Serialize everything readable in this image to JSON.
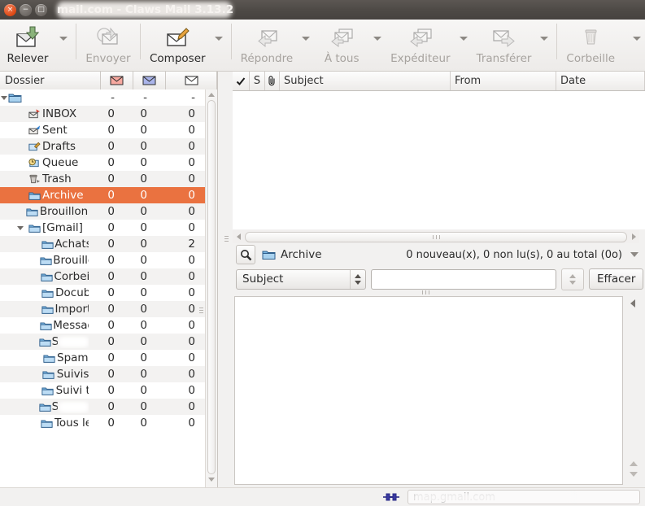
{
  "window": {
    "title_visible": "mail.com - Claws Mail 3.13.2",
    "title_redacted": true,
    "buttons": {
      "close": "×",
      "minimize": "−",
      "maximize": "□"
    },
    "accent_color": "#dd4814",
    "titlebar_color": "#4e4a46"
  },
  "toolbar": {
    "items": [
      {
        "label": "Relever",
        "icon": "get-mail-icon",
        "enabled": true,
        "has_arrow": true
      },
      {
        "label": "Envoyer",
        "icon": "send-mail-icon",
        "enabled": false,
        "has_arrow": false
      },
      {
        "label": "Composer",
        "icon": "compose-mail-icon",
        "enabled": true,
        "has_arrow": true
      },
      {
        "label": "Répondre",
        "icon": "reply-icon",
        "enabled": false,
        "has_arrow": true
      },
      {
        "label": "À tous",
        "icon": "reply-all-icon",
        "enabled": false,
        "has_arrow": true
      },
      {
        "label": "Expéditeur",
        "icon": "reply-sender-icon",
        "enabled": false,
        "has_arrow": true
      },
      {
        "label": "Transférer",
        "icon": "forward-icon",
        "enabled": false,
        "has_arrow": true
      },
      {
        "label": "Corbeille",
        "icon": "trash-icon",
        "enabled": false,
        "has_arrow": true
      }
    ]
  },
  "folder_pane": {
    "columns": [
      {
        "label": "Dossier",
        "icon": ""
      },
      {
        "label": "",
        "icon": "new-mail-icon"
      },
      {
        "label": "",
        "icon": "unread-mail-icon"
      },
      {
        "label": "",
        "icon": "total-mail-icon"
      }
    ],
    "rows": [
      {
        "name": "",
        "redacted": true,
        "icon": "account-folder-icon",
        "indent": 0,
        "twisty": "open",
        "new": "-",
        "unread": "-",
        "total": "-",
        "selected": false
      },
      {
        "name": "INBOX",
        "icon": "inbox-icon",
        "indent": 1,
        "twisty": "none",
        "new": "0",
        "unread": "0",
        "total": "0",
        "selected": false
      },
      {
        "name": "Sent",
        "icon": "sent-icon",
        "indent": 1,
        "twisty": "none",
        "new": "0",
        "unread": "0",
        "total": "0",
        "selected": false
      },
      {
        "name": "Drafts",
        "icon": "drafts-icon",
        "indent": 1,
        "twisty": "none",
        "new": "0",
        "unread": "0",
        "total": "0",
        "selected": false
      },
      {
        "name": "Queue",
        "icon": "queue-icon",
        "indent": 1,
        "twisty": "none",
        "new": "0",
        "unread": "0",
        "total": "0",
        "selected": false
      },
      {
        "name": "Trash",
        "icon": "trash-folder-icon",
        "indent": 1,
        "twisty": "none",
        "new": "0",
        "unread": "0",
        "total": "0",
        "selected": false
      },
      {
        "name": "Archive",
        "icon": "folder-icon",
        "indent": 1,
        "twisty": "none",
        "new": "0",
        "unread": "0",
        "total": "0",
        "selected": true
      },
      {
        "name": "Brouillons",
        "icon": "folder-icon",
        "indent": 1,
        "twisty": "none",
        "new": "0",
        "unread": "0",
        "total": "0",
        "selected": false
      },
      {
        "name": "[Gmail]",
        "icon": "folder-icon",
        "indent": 1,
        "twisty": "open",
        "new": "0",
        "unread": "0",
        "total": "0",
        "selected": false
      },
      {
        "name": "Achats",
        "icon": "folder-icon",
        "indent": 2,
        "twisty": "none",
        "new": "0",
        "unread": "0",
        "total": "2",
        "selected": false
      },
      {
        "name": "Brouillo",
        "icon": "folder-icon",
        "indent": 2,
        "twisty": "none",
        "new": "0",
        "unread": "0",
        "total": "0",
        "selected": false
      },
      {
        "name": "Corbeil",
        "icon": "folder-icon",
        "indent": 2,
        "twisty": "none",
        "new": "0",
        "unread": "0",
        "total": "0",
        "selected": false
      },
      {
        "name": "Docub",
        "icon": "folder-icon",
        "indent": 2,
        "twisty": "none",
        "new": "0",
        "unread": "0",
        "total": "0",
        "selected": false
      },
      {
        "name": "Import",
        "icon": "folder-icon",
        "indent": 2,
        "twisty": "none",
        "new": "0",
        "unread": "0",
        "total": "0",
        "selected": false
      },
      {
        "name": "Messag",
        "icon": "folder-icon",
        "indent": 2,
        "twisty": "none",
        "new": "0",
        "unread": "0",
        "total": "0",
        "selected": false
      },
      {
        "name": "S",
        "redacted": true,
        "icon": "folder-icon",
        "indent": 2,
        "twisty": "none",
        "new": "0",
        "unread": "0",
        "total": "0",
        "selected": false
      },
      {
        "name": "Spam",
        "icon": "folder-icon",
        "indent": 2,
        "twisty": "none",
        "new": "0",
        "unread": "0",
        "total": "0",
        "selected": false
      },
      {
        "name": "Suivis",
        "icon": "folder-icon",
        "indent": 2,
        "twisty": "none",
        "new": "0",
        "unread": "0",
        "total": "0",
        "selected": false
      },
      {
        "name": "Suivi t",
        "icon": "folder-icon",
        "indent": 2,
        "twisty": "none",
        "new": "0",
        "unread": "0",
        "total": "0",
        "selected": false
      },
      {
        "name": "S",
        "redacted": true,
        "icon": "folder-icon",
        "indent": 2,
        "twisty": "none",
        "new": "0",
        "unread": "0",
        "total": "0",
        "selected": false
      },
      {
        "name": "Tous le",
        "icon": "folder-icon",
        "indent": 2,
        "twisty": "none",
        "new": "0",
        "unread": "0",
        "total": "0",
        "selected": false
      }
    ],
    "selected_color": "#ea7240"
  },
  "message_list": {
    "columns": [
      {
        "label": "",
        "icon": "checkmark-icon"
      },
      {
        "label": "S",
        "icon": ""
      },
      {
        "label": "",
        "icon": "paperclip-icon"
      },
      {
        "label": "Subject",
        "icon": ""
      },
      {
        "label": "From",
        "icon": ""
      },
      {
        "label": "Date",
        "icon": ""
      }
    ],
    "rows": []
  },
  "status": {
    "folder_name": "Archive",
    "counts": "0 nouveau(x), 0 non lu(s), 0 au total (0o)",
    "search_icon": "magnifier-icon"
  },
  "search": {
    "field_selected": "Subject",
    "query_value": "",
    "query_placeholder": "",
    "clear_label": "Effacer"
  },
  "statusbar": {
    "server_visible": "map.gmail.com",
    "server_redacted": true,
    "connection_icon": "connection-icon"
  }
}
